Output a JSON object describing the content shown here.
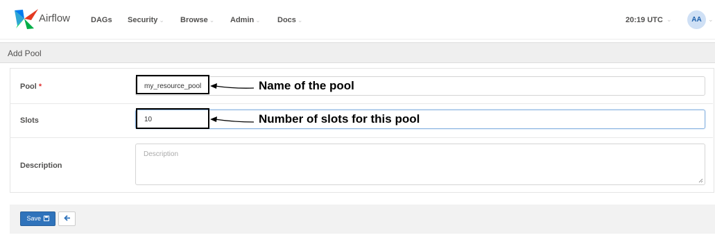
{
  "navbar": {
    "brand": "Airflow",
    "items": [
      {
        "label": "DAGs",
        "dropdown": false
      },
      {
        "label": "Security",
        "dropdown": true
      },
      {
        "label": "Browse",
        "dropdown": true
      },
      {
        "label": "Admin",
        "dropdown": true
      },
      {
        "label": "Docs",
        "dropdown": true
      }
    ],
    "caret": "⌄",
    "time": "20:19 UTC",
    "user_initials": "AA"
  },
  "page": {
    "title": "Add Pool"
  },
  "form": {
    "pool": {
      "label": "Pool",
      "required_mark": "*",
      "value": "my_resource_pool"
    },
    "slots": {
      "label": "Slots",
      "value": "10"
    },
    "description": {
      "label": "Description",
      "placeholder": "Description"
    }
  },
  "annotations": {
    "pool": "Name of the pool",
    "slots": "Number of slots for this pool"
  },
  "footer": {
    "save_label": "Save",
    "save_icon": "floppy-disk-icon",
    "back_icon": "arrow-left-icon"
  },
  "colors": {
    "primary": "#2f73bb",
    "required": "#e03030",
    "avatar_bg": "#cfe0f5"
  }
}
